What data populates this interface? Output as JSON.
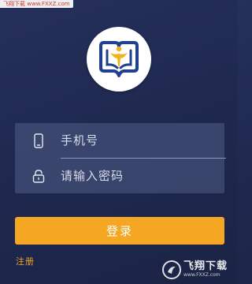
{
  "watermark_top": "飞翔下载 www.FXXZ.com",
  "logo": {
    "icon": "school-book-person-logo",
    "colors": {
      "blue": "#1f3f8f",
      "gold": "#f2b21b"
    }
  },
  "form": {
    "phone": {
      "placeholder": "手机号",
      "icon": "phone-icon"
    },
    "password": {
      "placeholder": "请输入密码",
      "icon": "lock-icon"
    }
  },
  "login_button": "登录",
  "register_link": "注册",
  "watermark_badge": {
    "cn": "飞翔下载",
    "en": "www.FXXZ.com"
  },
  "colors": {
    "accent": "#f5a623",
    "background": "#1f2950"
  }
}
